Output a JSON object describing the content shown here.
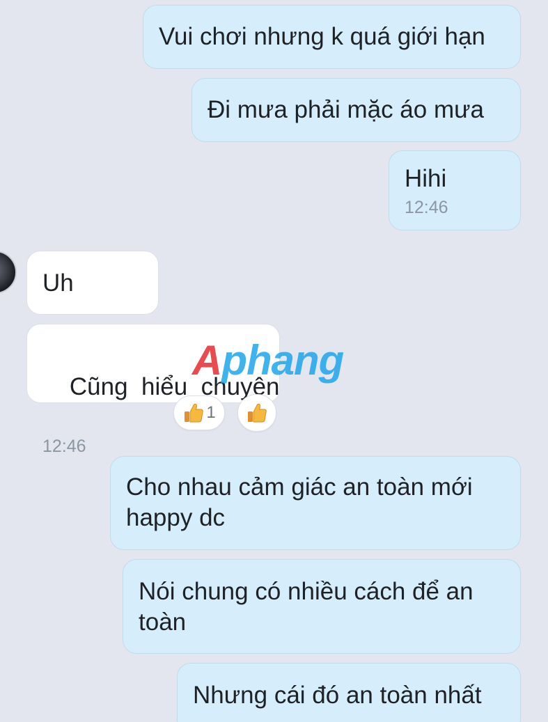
{
  "messages": [
    {
      "direction": "out",
      "text": "Vui chơi nhưng k quá giới hạn"
    },
    {
      "direction": "out",
      "text": "Đi mưa phải mặc áo mưa"
    },
    {
      "direction": "out",
      "text": "Hihi",
      "time": "12:46"
    },
    {
      "direction": "in",
      "text": "Uh"
    },
    {
      "direction": "in",
      "text": "Cũng  hiểu  chuyện",
      "time": "12:46"
    },
    {
      "direction": "out",
      "text": "Cho nhau cảm giác an toàn mới happy dc"
    },
    {
      "direction": "out",
      "text": "Nói chung có nhiều cách để an toàn"
    },
    {
      "direction": "out",
      "text": "Nhưng cái đó an toàn nhất"
    }
  ],
  "reactions": [
    {
      "icon": "thumbs-up-icon",
      "count": "1"
    },
    {
      "icon": "thumbs-up-icon",
      "count": ""
    }
  ],
  "watermark": {
    "first": "A",
    "rest": "phang"
  },
  "colors": {
    "background": "#e3e6ee",
    "outgoing_bubble": "#d6eefc",
    "incoming_bubble": "#ffffff",
    "time_text": "#8c96a3"
  }
}
